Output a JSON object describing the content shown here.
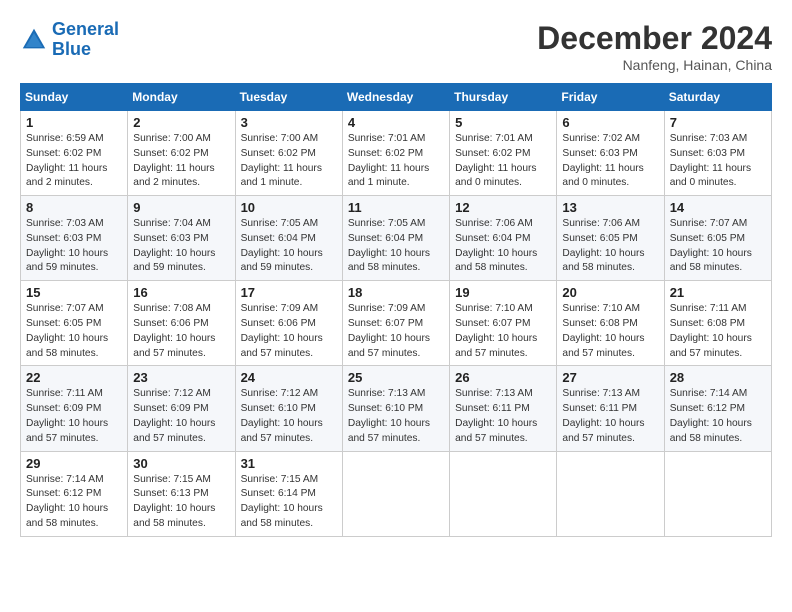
{
  "header": {
    "logo_general": "General",
    "logo_blue": "Blue",
    "month_title": "December 2024",
    "location": "Nanfeng, Hainan, China"
  },
  "weekdays": [
    "Sunday",
    "Monday",
    "Tuesday",
    "Wednesday",
    "Thursday",
    "Friday",
    "Saturday"
  ],
  "weeks": [
    [
      {
        "day": "1",
        "info": "Sunrise: 6:59 AM\nSunset: 6:02 PM\nDaylight: 11 hours\nand 2 minutes."
      },
      {
        "day": "2",
        "info": "Sunrise: 7:00 AM\nSunset: 6:02 PM\nDaylight: 11 hours\nand 2 minutes."
      },
      {
        "day": "3",
        "info": "Sunrise: 7:00 AM\nSunset: 6:02 PM\nDaylight: 11 hours\nand 1 minute."
      },
      {
        "day": "4",
        "info": "Sunrise: 7:01 AM\nSunset: 6:02 PM\nDaylight: 11 hours\nand 1 minute."
      },
      {
        "day": "5",
        "info": "Sunrise: 7:01 AM\nSunset: 6:02 PM\nDaylight: 11 hours\nand 0 minutes."
      },
      {
        "day": "6",
        "info": "Sunrise: 7:02 AM\nSunset: 6:03 PM\nDaylight: 11 hours\nand 0 minutes."
      },
      {
        "day": "7",
        "info": "Sunrise: 7:03 AM\nSunset: 6:03 PM\nDaylight: 11 hours\nand 0 minutes."
      }
    ],
    [
      {
        "day": "8",
        "info": "Sunrise: 7:03 AM\nSunset: 6:03 PM\nDaylight: 10 hours\nand 59 minutes."
      },
      {
        "day": "9",
        "info": "Sunrise: 7:04 AM\nSunset: 6:03 PM\nDaylight: 10 hours\nand 59 minutes."
      },
      {
        "day": "10",
        "info": "Sunrise: 7:05 AM\nSunset: 6:04 PM\nDaylight: 10 hours\nand 59 minutes."
      },
      {
        "day": "11",
        "info": "Sunrise: 7:05 AM\nSunset: 6:04 PM\nDaylight: 10 hours\nand 58 minutes."
      },
      {
        "day": "12",
        "info": "Sunrise: 7:06 AM\nSunset: 6:04 PM\nDaylight: 10 hours\nand 58 minutes."
      },
      {
        "day": "13",
        "info": "Sunrise: 7:06 AM\nSunset: 6:05 PM\nDaylight: 10 hours\nand 58 minutes."
      },
      {
        "day": "14",
        "info": "Sunrise: 7:07 AM\nSunset: 6:05 PM\nDaylight: 10 hours\nand 58 minutes."
      }
    ],
    [
      {
        "day": "15",
        "info": "Sunrise: 7:07 AM\nSunset: 6:05 PM\nDaylight: 10 hours\nand 58 minutes."
      },
      {
        "day": "16",
        "info": "Sunrise: 7:08 AM\nSunset: 6:06 PM\nDaylight: 10 hours\nand 57 minutes."
      },
      {
        "day": "17",
        "info": "Sunrise: 7:09 AM\nSunset: 6:06 PM\nDaylight: 10 hours\nand 57 minutes."
      },
      {
        "day": "18",
        "info": "Sunrise: 7:09 AM\nSunset: 6:07 PM\nDaylight: 10 hours\nand 57 minutes."
      },
      {
        "day": "19",
        "info": "Sunrise: 7:10 AM\nSunset: 6:07 PM\nDaylight: 10 hours\nand 57 minutes."
      },
      {
        "day": "20",
        "info": "Sunrise: 7:10 AM\nSunset: 6:08 PM\nDaylight: 10 hours\nand 57 minutes."
      },
      {
        "day": "21",
        "info": "Sunrise: 7:11 AM\nSunset: 6:08 PM\nDaylight: 10 hours\nand 57 minutes."
      }
    ],
    [
      {
        "day": "22",
        "info": "Sunrise: 7:11 AM\nSunset: 6:09 PM\nDaylight: 10 hours\nand 57 minutes."
      },
      {
        "day": "23",
        "info": "Sunrise: 7:12 AM\nSunset: 6:09 PM\nDaylight: 10 hours\nand 57 minutes."
      },
      {
        "day": "24",
        "info": "Sunrise: 7:12 AM\nSunset: 6:10 PM\nDaylight: 10 hours\nand 57 minutes."
      },
      {
        "day": "25",
        "info": "Sunrise: 7:13 AM\nSunset: 6:10 PM\nDaylight: 10 hours\nand 57 minutes."
      },
      {
        "day": "26",
        "info": "Sunrise: 7:13 AM\nSunset: 6:11 PM\nDaylight: 10 hours\nand 57 minutes."
      },
      {
        "day": "27",
        "info": "Sunrise: 7:13 AM\nSunset: 6:11 PM\nDaylight: 10 hours\nand 57 minutes."
      },
      {
        "day": "28",
        "info": "Sunrise: 7:14 AM\nSunset: 6:12 PM\nDaylight: 10 hours\nand 58 minutes."
      }
    ],
    [
      {
        "day": "29",
        "info": "Sunrise: 7:14 AM\nSunset: 6:12 PM\nDaylight: 10 hours\nand 58 minutes."
      },
      {
        "day": "30",
        "info": "Sunrise: 7:15 AM\nSunset: 6:13 PM\nDaylight: 10 hours\nand 58 minutes."
      },
      {
        "day": "31",
        "info": "Sunrise: 7:15 AM\nSunset: 6:14 PM\nDaylight: 10 hours\nand 58 minutes."
      },
      null,
      null,
      null,
      null
    ]
  ]
}
